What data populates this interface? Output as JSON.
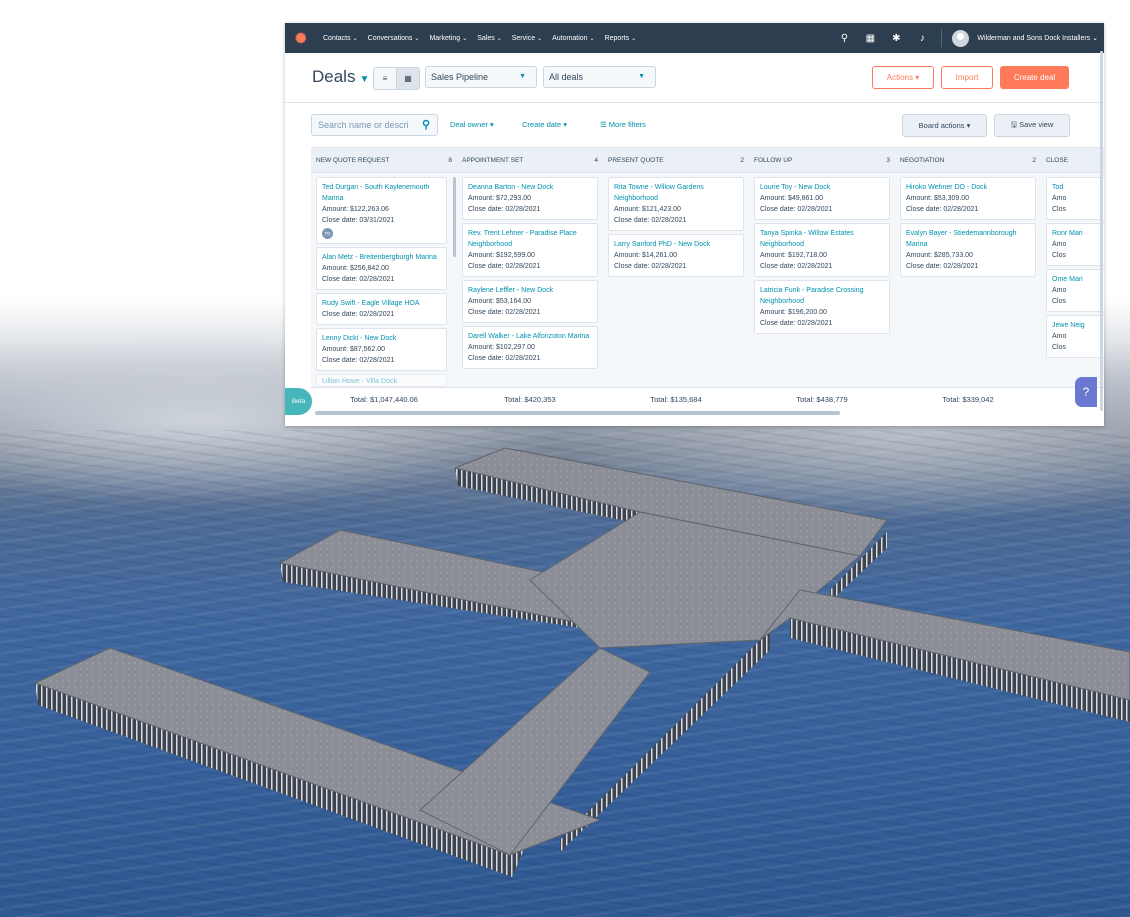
{
  "nav": {
    "items": [
      {
        "label": "Contacts",
        "caret": "⌄"
      },
      {
        "label": "Conversations",
        "caret": "⌄"
      },
      {
        "label": "Marketing",
        "caret": "⌄"
      },
      {
        "label": "Sales",
        "caret": "⌄"
      },
      {
        "label": "Service",
        "caret": "⌄"
      },
      {
        "label": "Automation",
        "caret": "⌄"
      },
      {
        "label": "Reports",
        "caret": "⌄"
      }
    ],
    "account": "Wilderman and Sons Dock Installers ⌄",
    "icons": [
      "search-icon",
      "marketplace-icon",
      "settings-icon",
      "notifications-icon"
    ]
  },
  "header": {
    "title": "Deals",
    "pipeline": "Sales Pipeline",
    "view": "All deals",
    "actions": "Actions ▾",
    "import": "Import",
    "create": "Create deal"
  },
  "filters": {
    "search_placeholder": "Search name or descri",
    "deal_owner": "Deal owner ▾",
    "create_date": "Create date ▾",
    "more_filters": "☰ More filters",
    "board_actions": "Board actions ▾",
    "save_view": "🖫 Save view"
  },
  "board": {
    "columns": [
      {
        "title": "NEW QUOTE REQUEST",
        "count": "8",
        "cards": [
          {
            "name": "Ted Durgan - South Kaylenemouth Marina",
            "amount": "Amount: $122,263.06",
            "close": "Close date: 03/31/2021",
            "owner": "TD"
          },
          {
            "name": "Alan Metz - Breitenbergburgh Marina",
            "amount": "Amount: $256,842.00",
            "close": "Close date: 02/28/2021"
          },
          {
            "name": "Rudy Swift - Eagle Village HOA",
            "amount": "",
            "close": "Close date: 02/28/2021"
          },
          {
            "name": "Lenny Dicki - New Dock",
            "amount": "Amount: $87,562.00",
            "close": "Close date: 02/28/2021"
          },
          {
            "name": "Lillian Howe - Villa Dock",
            "amount": "",
            "close": ""
          }
        ],
        "total": "Total: $1,047,440.06"
      },
      {
        "title": "APPOINTMENT SET",
        "count": "4",
        "cards": [
          {
            "name": "Deanna Barton - New Dock",
            "amount": "Amount: $72,293.00",
            "close": "Close date: 02/28/2021"
          },
          {
            "name": "Rev. Trent Lehner - Paradise Place Neighborhood",
            "amount": "Amount: $192,599.00",
            "close": "Close date: 02/28/2021"
          },
          {
            "name": "Raylene Leffler - New Dock",
            "amount": "Amount: $53,164.00",
            "close": "Close date: 02/28/2021"
          },
          {
            "name": "Darell Walker - Lake Alfonzoton Marina",
            "amount": "Amount: $102,297.00",
            "close": "Close date: 02/28/2021"
          }
        ],
        "total": "Total: $420,353"
      },
      {
        "title": "PRESENT QUOTE",
        "count": "2",
        "cards": [
          {
            "name": "Rita Towne - Willow Gardens Neighborhood",
            "amount": "Amount: $121,423.00",
            "close": "Close date: 02/28/2021"
          },
          {
            "name": "Larry Sanford PhD - New Dock",
            "amount": "Amount: $14,261.00",
            "close": "Close date: 02/28/2021"
          }
        ],
        "total": "Total: $135,684"
      },
      {
        "title": "FOLLOW UP",
        "count": "3",
        "cards": [
          {
            "name": "Lourie Toy - New Dock",
            "amount": "Amount: $49,861.00",
            "close": "Close date: 02/28/2021"
          },
          {
            "name": "Tanya Spinka - Willow Estates Neighborhood",
            "amount": "Amount: $192,718.00",
            "close": "Close date: 02/28/2021"
          },
          {
            "name": "Latricia Funk - Paradise Crossing Neighborhood",
            "amount": "Amount: $196,200.00",
            "close": "Close date: 02/28/2021"
          }
        ],
        "total": "Total: $438,779"
      },
      {
        "title": "NEGOTIATION",
        "count": "2",
        "cards": [
          {
            "name": "Hiroko Wehner DO - Dock",
            "amount": "Amount: $53,309.00",
            "close": "Close date: 02/28/2021"
          },
          {
            "name": "Evalyn Bayer - Stiedemannborough Marina",
            "amount": "Amount: $285,733.00",
            "close": "Close date: 02/28/2021"
          }
        ],
        "total": "Total: $339,042"
      },
      {
        "title": "CLOSE",
        "count": "",
        "cards": [
          {
            "name": "Tod",
            "amount": "Amo",
            "close": "Clos"
          },
          {
            "name": "Ronr Mari",
            "amount": "Amo",
            "close": "Clos"
          },
          {
            "name": "Ome Mari",
            "amount": "Amo",
            "close": "Clos"
          },
          {
            "name": "Jewe Neig",
            "amount": "Amo",
            "close": "Clos"
          }
        ],
        "total": ""
      }
    ]
  },
  "badges": {
    "beta": "Beta",
    "help": "?"
  },
  "colors": {
    "nav_bg": "#2d3e50",
    "accent": "#ff7a59",
    "link": "#0091ae",
    "beta": "#45b6b9",
    "help": "#6a78d1"
  }
}
